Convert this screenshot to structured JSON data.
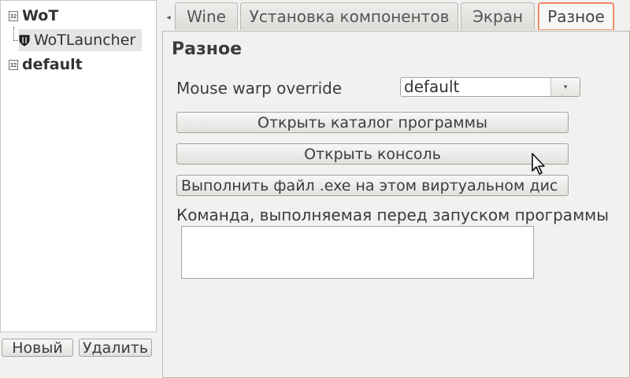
{
  "tree": {
    "items": [
      {
        "label": "WoT",
        "icon": "win32-prefix-icon"
      },
      {
        "label": "WoTLauncher",
        "icon": "shield-icon"
      },
      {
        "label": "default",
        "icon": "win32-prefix-icon"
      }
    ],
    "prefix_icon_text": "32"
  },
  "left_buttons": {
    "new_label": "Новый",
    "delete_label": "Удалить"
  },
  "tabs": [
    {
      "label": "Wine"
    },
    {
      "label": "Установка компонентов"
    },
    {
      "label": "Экран"
    },
    {
      "label": "Разное",
      "active": true
    }
  ],
  "tab_scroll": {
    "left_arrow": "◂"
  },
  "page": {
    "title": "Разное",
    "mouse_warp_label": "Mouse warp override",
    "mouse_warp_value": "default",
    "combo_arrow": "▾",
    "open_dir_button": "Открыть каталог программы",
    "open_console_button": "Открыть консоль",
    "run_exe_button": "Выполнить файл .exe на этом виртуальном дис",
    "pre_command_label": "Команда, выполняемая перед запуском программы",
    "pre_command_value": ""
  },
  "colors": {
    "active_tab_border": "#e8754f",
    "window_bg": "#f2f1f0"
  }
}
